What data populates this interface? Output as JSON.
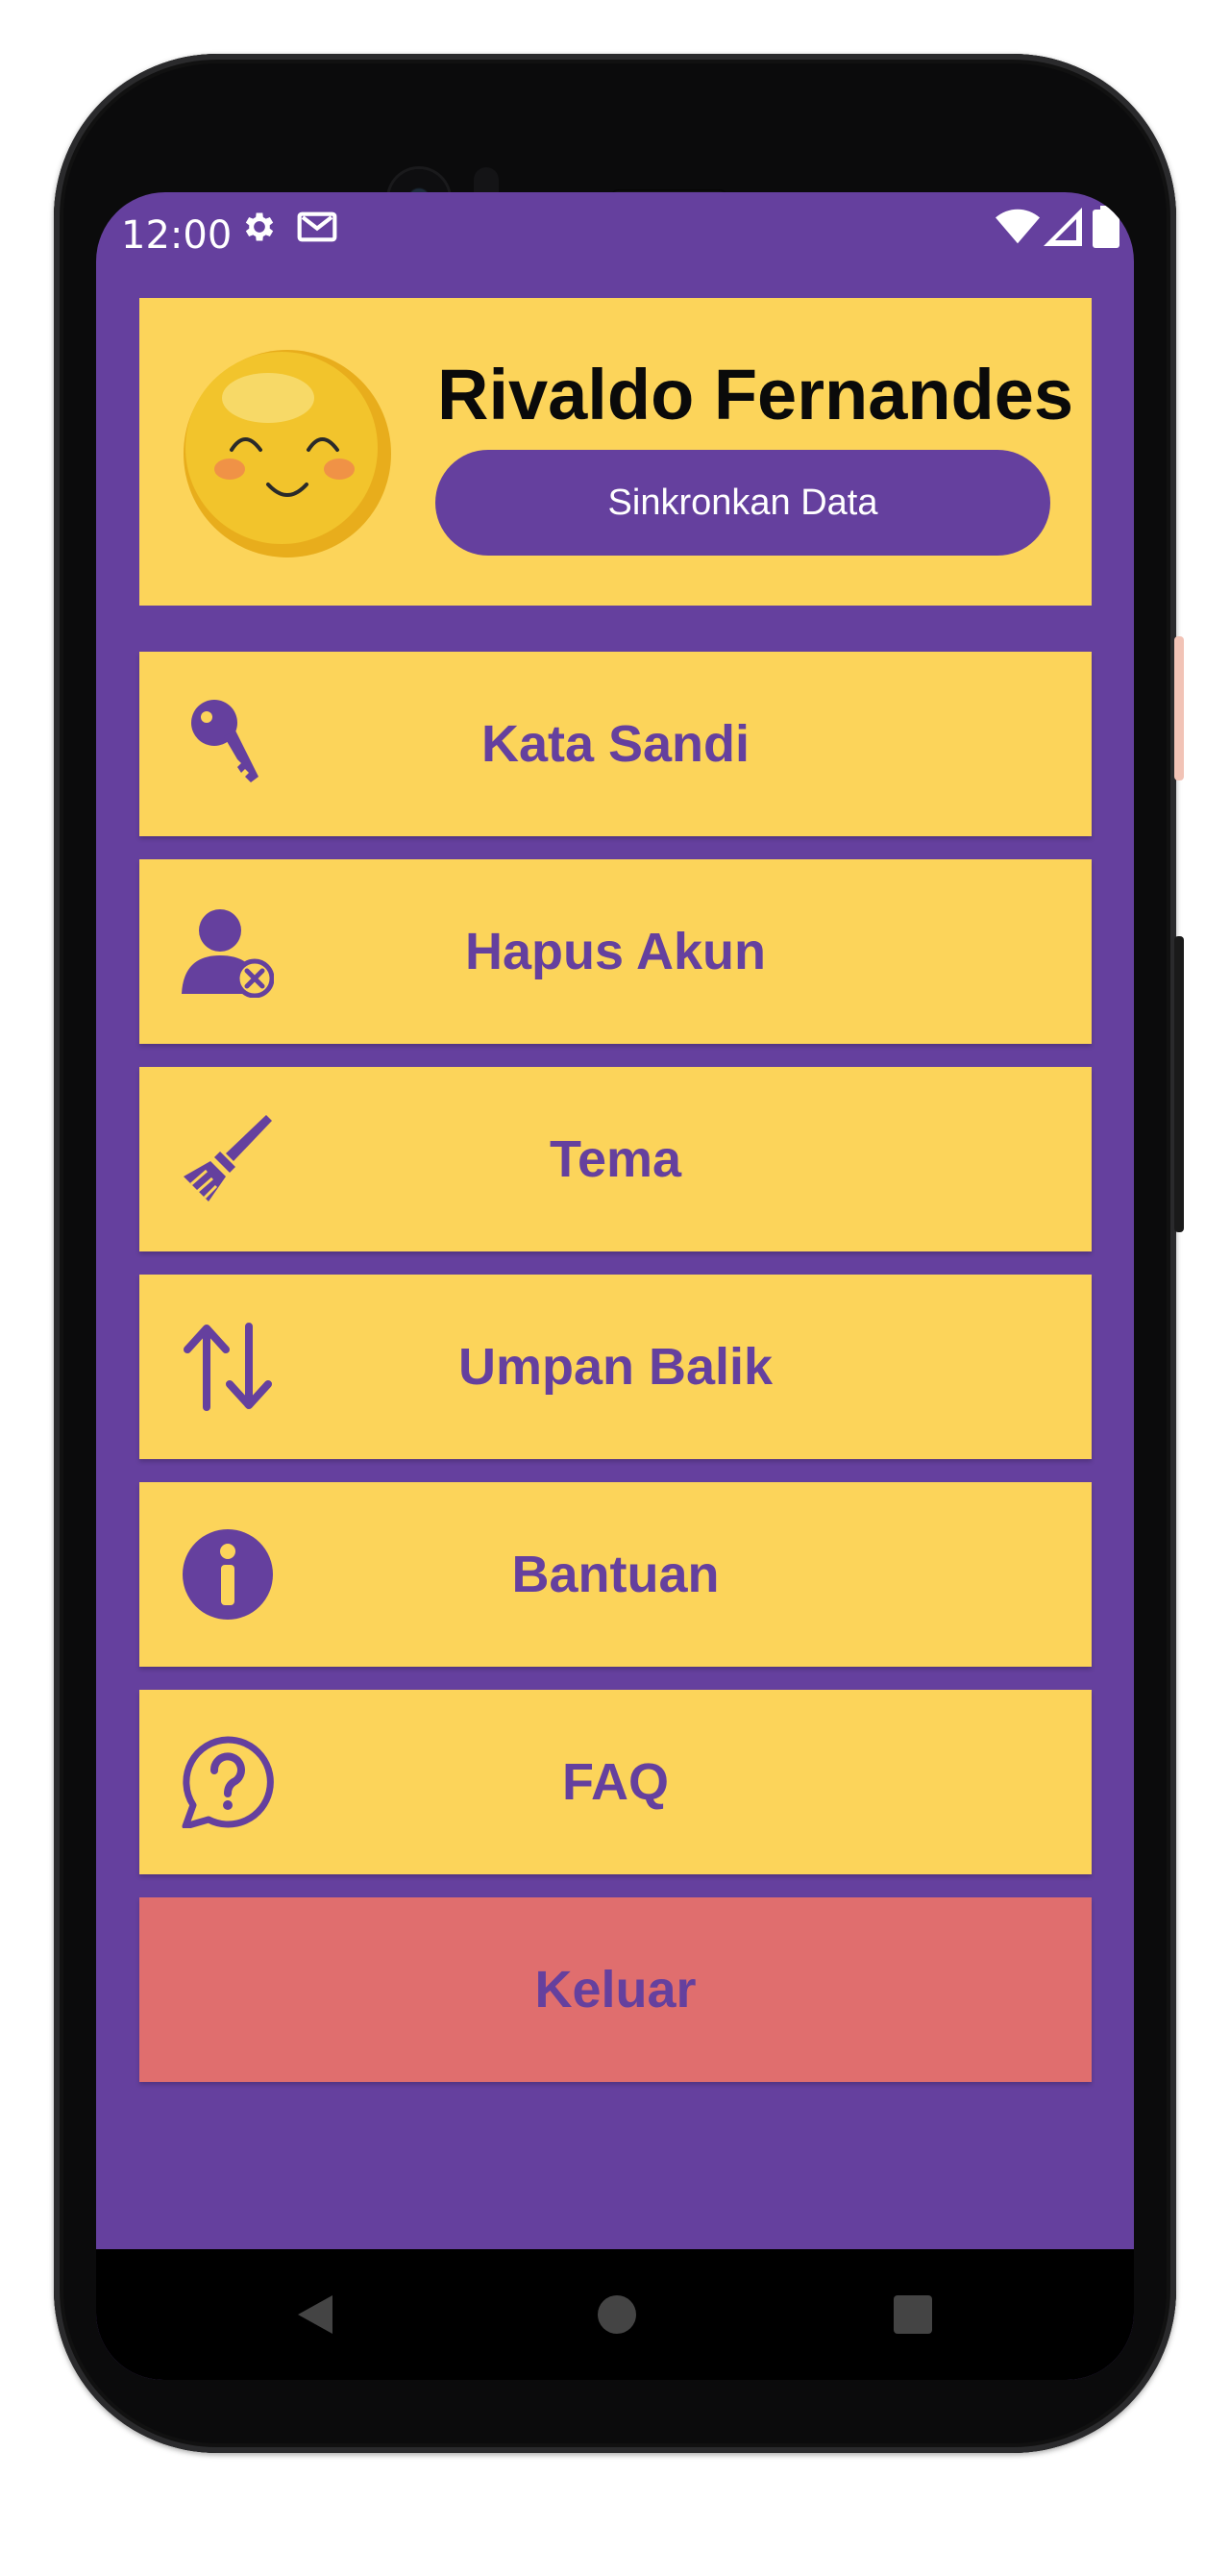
{
  "status_bar": {
    "time": "12:00",
    "left_icons": [
      "gear-icon",
      "gmail-icon"
    ],
    "right_icons": [
      "wifi-icon",
      "signal-icon",
      "battery-icon"
    ]
  },
  "profile": {
    "name": "Rivaldo Fernandes",
    "sync_button": "Sinkronkan Data",
    "avatar_icon": "smiling-emoji-icon"
  },
  "menu": [
    {
      "label": "Kata Sandi",
      "icon": "key-icon"
    },
    {
      "label": "Hapus Akun",
      "icon": "remove-user-icon"
    },
    {
      "label": "Tema",
      "icon": "paint-brush-icon"
    },
    {
      "label": "Umpan Balik",
      "icon": "up-down-arrows-icon"
    },
    {
      "label": "Bantuan",
      "icon": "info-icon"
    },
    {
      "label": "FAQ",
      "icon": "question-bubble-icon"
    }
  ],
  "logout": {
    "label": "Keluar"
  },
  "nav": [
    "back-icon",
    "home-icon",
    "recents-icon"
  ],
  "colors": {
    "background": "#65409e",
    "card": "#fcd45a",
    "logout": "#e06e6e",
    "accent_text": "#65409e"
  }
}
